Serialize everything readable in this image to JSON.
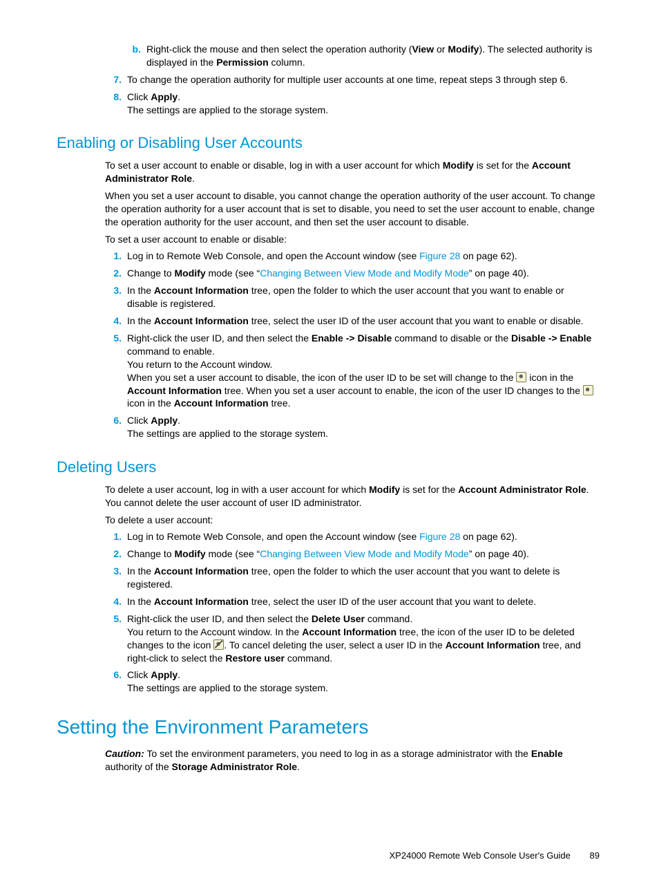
{
  "top": {
    "b_label": "b.",
    "b_text1": "Right-click the mouse and then select the operation authority (",
    "b_view": "View",
    "b_or": " or ",
    "b_modify": "Modify",
    "b_text2": "). The selected authority is displayed in the ",
    "b_perm": "Permission",
    "b_text3": " column.",
    "n7": "7.",
    "t7": "To change the operation authority for multiple user accounts at one time, repeat steps 3 through step 6.",
    "n8": "8.",
    "t8a": "Click ",
    "t8apply": "Apply",
    "t8b": ".",
    "t8c": "The settings are applied to the storage system."
  },
  "sec1": {
    "title": "Enabling or Disabling User Accounts",
    "p1a": "To set a user account to enable or disable, log in with a user account for which ",
    "p1mod": "Modify",
    "p1b": " is set for the ",
    "p1role": "Account Administrator Role",
    "p1c": ".",
    "p2": "When you set a user account to disable, you cannot change the operation authority of the user account. To change the operation authority for a user account that is set to disable, you need to set the user account to enable, change the operation authority for the user account, and then set the user account to disable.",
    "p3": "To set a user account to enable or disable:",
    "l1n": "1.",
    "l1a": "Log in to Remote Web Console, and open the Account window (see ",
    "l1link": "Figure 28",
    "l1b": " on page 62).",
    "l2n": "2.",
    "l2a": "Change to ",
    "l2mod": "Modify",
    "l2b": " mode (see “",
    "l2link": "Changing Between View Mode and Modify Mode",
    "l2c": "” on page 40).",
    "l3n": "3.",
    "l3a": "In the ",
    "l3ai": "Account Information",
    "l3b": " tree, open the folder to which the user account that you want to enable or disable is registered.",
    "l4n": "4.",
    "l4a": "In the ",
    "l4ai": "Account Information",
    "l4b": " tree, select the user ID of the user account that you want to enable or disable.",
    "l5n": "5.",
    "l5a": "Right-click the user ID, and then select the ",
    "l5e2d": "Enable -> Disable",
    "l5b": " command to disable or the ",
    "l5d2e": "Disable -> Enable",
    "l5c": " command to enable.",
    "l5d": "You return to the Account window.",
    "l5e": "When you set a user account to disable, the icon of the user ID to be set will change to the ",
    "l5f": " icon in the ",
    "l5ai": "Account Information",
    "l5g": " tree. When you set a user account to enable, the icon of the user ID changes to the ",
    "l5h": " icon in the ",
    "l5i": " tree.",
    "l6n": "6.",
    "l6a": "Click ",
    "l6apply": "Apply",
    "l6b": ".",
    "l6c": "The settings are applied to the storage system."
  },
  "sec2": {
    "title": "Deleting Users",
    "p1a": "To delete a user account, log in with a user account for which ",
    "p1mod": "Modify",
    "p1b": " is set for the ",
    "p1role": "Account Administrator Role",
    "p1c": ". You cannot delete the user account of user ID administrator.",
    "p2": "To delete a user account:",
    "l1n": "1.",
    "l1a": "Log in to Remote Web Console, and open the Account window (see ",
    "l1link": "Figure 28",
    "l1b": " on page 62).",
    "l2n": "2.",
    "l2a": "Change to ",
    "l2mod": "Modify",
    "l2b": " mode (see “",
    "l2link": "Changing Between View Mode and Modify Mode",
    "l2c": "” on page 40).",
    "l3n": "3.",
    "l3a": "In the ",
    "l3ai": "Account Information",
    "l3b": " tree, open the folder to which the user account that you want to delete is registered.",
    "l4n": "4.",
    "l4a": "In the ",
    "l4ai": "Account Information",
    "l4b": " tree, select the user ID of the user account that you want to delete.",
    "l5n": "5.",
    "l5a": "Right-click the user ID, and then select the ",
    "l5del": "Delete User",
    "l5b": " command.",
    "l5c": "You return to the Account window. In the ",
    "l5ai": "Account Information",
    "l5d": " tree, the icon of the user ID to be deleted changes to the icon ",
    "l5e": ". To cancel deleting the user, select a user ID in the ",
    "l5f": " tree, and right-click to select the ",
    "l5rest": "Restore user",
    "l5g": " command.",
    "l6n": "6.",
    "l6a": "Click ",
    "l6apply": "Apply",
    "l6b": ".",
    "l6c": "The settings are applied to the storage system."
  },
  "chap": {
    "title": "Setting the Environment Parameters",
    "caution": "Caution:",
    "p1a": " To set the environment parameters, you need to log in as a storage administrator with the ",
    "enable": "Enable",
    "p1b": " authority of the ",
    "role": "Storage Administrator Role",
    "p1c": "."
  },
  "footer": {
    "guide": "XP24000 Remote Web Console User's Guide",
    "page": "89"
  }
}
